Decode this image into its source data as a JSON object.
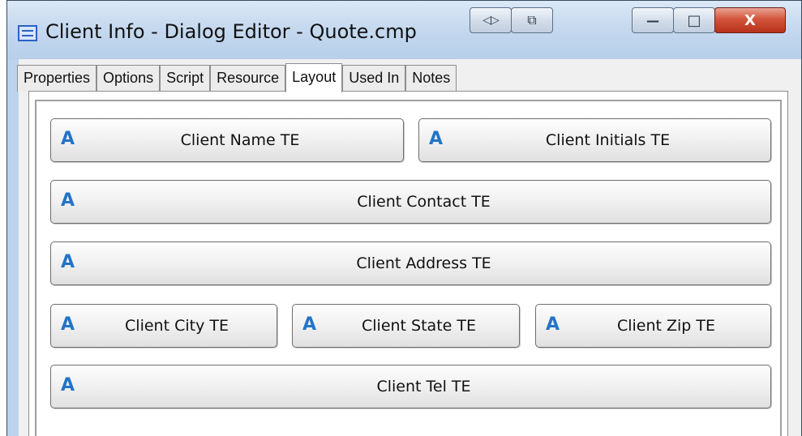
{
  "window": {
    "title": "Client Info - Dialog Editor - Quote.cmp",
    "app_icon": "dialog-window-icon",
    "title_buttons": [
      {
        "name": "split-view-button",
        "glyph": "◁▷"
      },
      {
        "name": "dock-button",
        "glyph": "⧉"
      },
      {
        "name": "minimize-button",
        "glyph": "—"
      },
      {
        "name": "maximize-button",
        "glyph": "□"
      },
      {
        "name": "close-button",
        "glyph": "X"
      }
    ]
  },
  "tabs": [
    {
      "label": "Properties"
    },
    {
      "label": "Options"
    },
    {
      "label": "Script"
    },
    {
      "label": "Resource"
    },
    {
      "label": "Layout",
      "active": true
    },
    {
      "label": "Used In"
    },
    {
      "label": "Notes"
    }
  ],
  "layout": {
    "field_icon": "text-edit-icon",
    "field_glyph": "A",
    "fields": [
      {
        "name": "client-name-field",
        "label": "Client Name TE"
      },
      {
        "name": "client-initials-field",
        "label": "Client Initials TE"
      },
      {
        "name": "client-contact-field",
        "label": "Client Contact TE"
      },
      {
        "name": "client-address-field",
        "label": "Client Address TE"
      },
      {
        "name": "client-city-field",
        "label": "Client City TE"
      },
      {
        "name": "client-state-field",
        "label": "Client State TE"
      },
      {
        "name": "client-zip-field",
        "label": "Client Zip TE"
      },
      {
        "name": "client-tel-field",
        "label": "Client Tel TE"
      }
    ]
  },
  "colors": {
    "accent_glyph": "#2274c9",
    "close_button": "#c9432a",
    "titlebar": "#c6d9ef"
  }
}
